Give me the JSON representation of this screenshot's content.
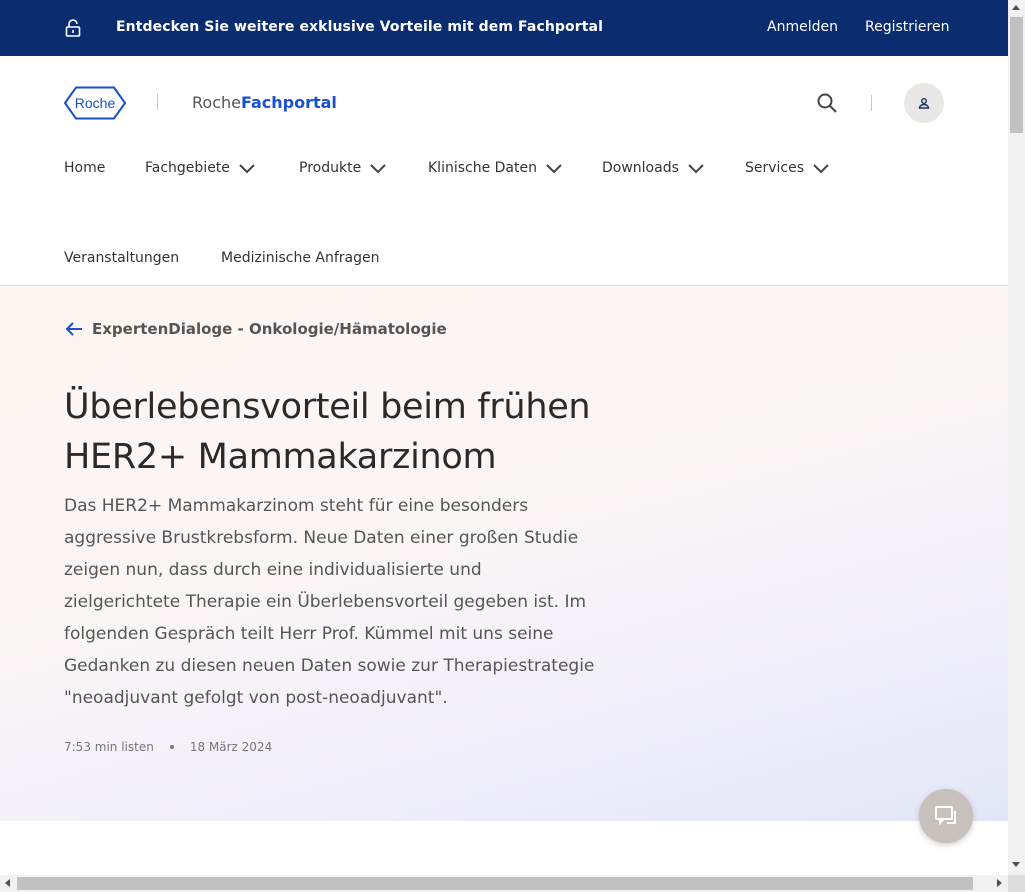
{
  "topbar": {
    "promo": "Entdecken Sie weitere exklusive Vorteile mit dem Fachportal",
    "login": "Anmelden",
    "register": "Registrieren",
    "icon": "lock-open-icon"
  },
  "header": {
    "logo_text": "Roche",
    "portal_part1": "Roche",
    "portal_part2": "Fachportal",
    "search_icon": "search-icon",
    "user_icon": "user-icon"
  },
  "nav": {
    "items": [
      {
        "label": "Home",
        "dropdown": false
      },
      {
        "label": "Fachgebiete",
        "dropdown": true
      },
      {
        "label": "Produkte",
        "dropdown": true
      },
      {
        "label": "Klinische Daten",
        "dropdown": true
      },
      {
        "label": "Downloads",
        "dropdown": true
      },
      {
        "label": "Services",
        "dropdown": true
      }
    ],
    "row2": [
      {
        "label": "Veranstaltungen"
      },
      {
        "label": "Medizinische Anfragen"
      }
    ]
  },
  "hero": {
    "back_label": "ExpertenDialoge - Onkologie/Hämatologie",
    "title_line1": "Überlebensvorteil beim frühen",
    "title_line2": "HER2+ Mammakarzinom",
    "lead": "Das HER2+ Mammakarzinom steht für eine besonders aggressive Brustkrebsform. Neue Daten einer großen Studie zeigen nun, dass durch eine individualisierte und zielgerichtete Therapie ein Überlebensvorteil gegeben ist. Im folgenden Gespräch teilt Herr Prof. Kümmel mit uns seine Gedanken zu diesen neuen Daten sowie zur Therapiestrategie \"neoadjuvant gefolgt von post-neoadjuvant\".",
    "duration": "7:53 min listen",
    "date": "18 März 2024"
  },
  "colors": {
    "topbar_bg": "#0b2d6f",
    "brand_blue": "#1a4fd0",
    "chat_bg": "#c8c0bb"
  }
}
